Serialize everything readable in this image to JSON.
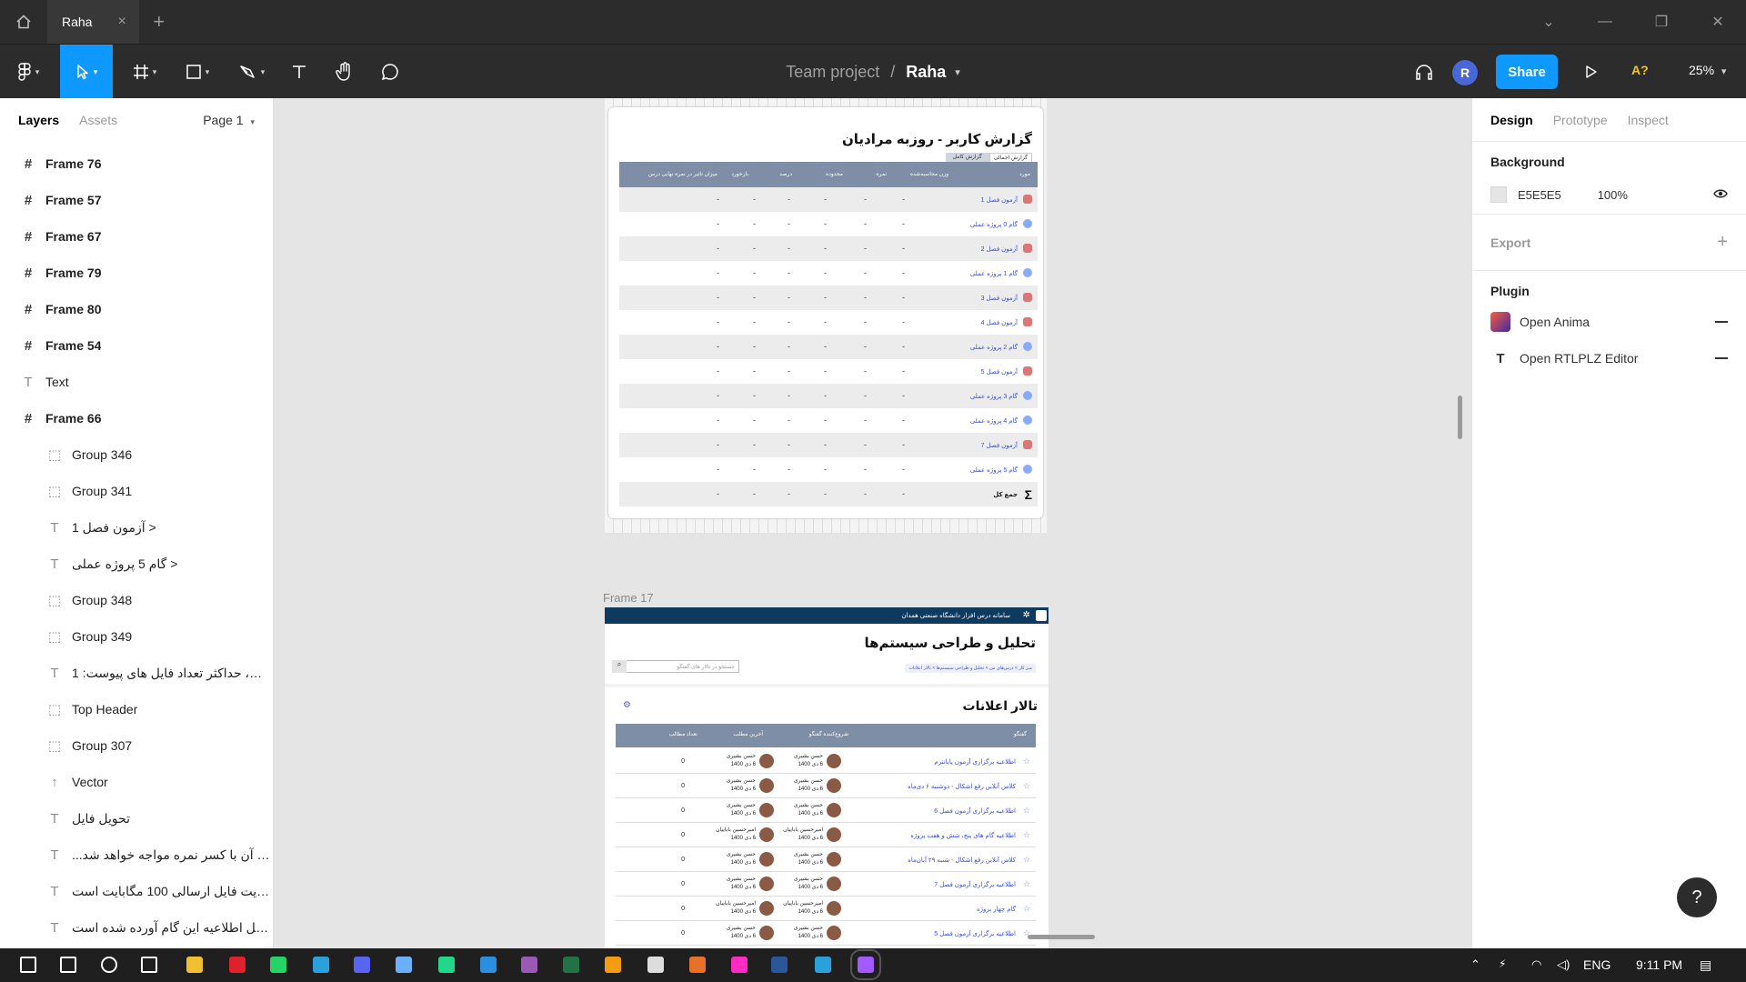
{
  "titlebar": {
    "tab_label": "Raha",
    "tab_close": "×",
    "new_tab": "+",
    "window_controls": [
      "⌄",
      "—",
      "❐",
      "✕"
    ]
  },
  "toolbar": {
    "breadcrumb_team": "Team project",
    "breadcrumb_sep": "/",
    "breadcrumb_file": "Raha",
    "avatar_initial": "R",
    "share_label": "Share",
    "font_check": "A?",
    "zoom": "25%",
    "caret": "▾"
  },
  "left_panel": {
    "tab_layers": "Layers",
    "tab_assets": "Assets",
    "page": "Page 1",
    "layers": [
      {
        "icon": "#",
        "name": "Frame 76",
        "level": "top"
      },
      {
        "icon": "#",
        "name": "Frame 57",
        "level": "top"
      },
      {
        "icon": "#",
        "name": "Frame 67",
        "level": "top"
      },
      {
        "icon": "#",
        "name": "Frame 79",
        "level": "top"
      },
      {
        "icon": "#",
        "name": "Frame 80",
        "level": "top"
      },
      {
        "icon": "#",
        "name": "Frame 54",
        "level": "top"
      },
      {
        "icon": "T",
        "name": "Text",
        "level": "top-plain"
      },
      {
        "icon": "#",
        "name": "Frame 66",
        "level": "top"
      },
      {
        "icon": "⬚",
        "name": "Group 346",
        "level": "child"
      },
      {
        "icon": "⬚",
        "name": "Group 341",
        "level": "child"
      },
      {
        "icon": "T",
        "name": "آزمون فصل 1 >",
        "level": "child"
      },
      {
        "icon": "T",
        "name": "گام 5 پروژه عملی >",
        "level": "child"
      },
      {
        "icon": "⬚",
        "name": "Group 348",
        "level": "child"
      },
      {
        "icon": "⬚",
        "name": "Group 349",
        "level": "child"
      },
      {
        "icon": "T",
        "name": "مگابایت، حداکثر تعداد فایل های پیوست: 1 ...",
        "level": "child"
      },
      {
        "icon": "⬚",
        "name": "Top Header",
        "level": "child"
      },
      {
        "icon": "⬚",
        "name": "Group 307",
        "level": "child"
      },
      {
        "icon": "↑",
        "name": "Vector",
        "level": "child"
      },
      {
        "icon": "T",
        "name": "تحویل فایل",
        "level": "child"
      },
      {
        "icon": "T",
        "name": "...عایت آن با کسر نمره مواجه خواهد شد **",
        "level": "child"
      },
      {
        "icon": "T",
        "name": "محدودیت فایل ارسالی 100 مگابایت است *...",
        "level": "child"
      },
      {
        "icon": "T",
        "name": "ویدیو داخل اطلاعیه این گام آورده شده است...",
        "level": "child"
      }
    ]
  },
  "right_panel": {
    "tabs": [
      "Design",
      "Prototype",
      "Inspect"
    ],
    "background_title": "Background",
    "background_hex": "E5E5E5",
    "background_opacity": "100%",
    "export_title": "Export",
    "plugin_title": "Plugin",
    "plugins": [
      "Open Anima",
      "Open RTLPLZ Editor"
    ]
  },
  "canvas": {
    "report_frame": {
      "title": "گزارش کاربر - روزبه مرادیان",
      "tabs": [
        "گزارش اجمالی",
        "گزارش کامل"
      ],
      "columns": [
        "مورد",
        "وزن محاسبه‌شده",
        "نمره",
        "محدوده",
        "درصد",
        "بازخورد",
        "میزان تاثیر در نمره نهایی درس"
      ],
      "rows": [
        {
          "label": "آزمون فصل 1",
          "kind": "quiz"
        },
        {
          "label": "گام 0 پروژه عملی",
          "kind": "step"
        },
        {
          "label": "آزمون فصل 2",
          "kind": "quiz"
        },
        {
          "label": "گام 1 پروژه عملی",
          "kind": "step"
        },
        {
          "label": "آزمون فصل 3",
          "kind": "quiz"
        },
        {
          "label": "آزمون فصل 4",
          "kind": "quiz"
        },
        {
          "label": "گام 2 پروژه عملی",
          "kind": "step"
        },
        {
          "label": "آزمون فصل 5",
          "kind": "quiz"
        },
        {
          "label": "گام 3 پروژه عملی",
          "kind": "step"
        },
        {
          "label": "گام 4 پروژه عملی",
          "kind": "step"
        },
        {
          "label": "آزمون فصل 7",
          "kind": "quiz"
        },
        {
          "label": "گام 5 پروژه عملی",
          "kind": "step"
        }
      ],
      "total_label": "جمع کل",
      "dash": "-"
    },
    "frame17": {
      "label": "Frame 17",
      "header": "سامانه درس افزار دانشگاه صنعتی همدان",
      "course_title": "تحلیل و طراحی سیستم‌ها",
      "search_placeholder": "جستجو در تالار های گفتگو",
      "breadcrumb": "میز کار > درس‌های من > تحلیل و طراحی سیستم‌ها > تالار اعلانات",
      "forum_title": "تالار اعلانات",
      "columns": [
        "گفتگو",
        "شروع‌کننده گفتگو",
        "آخرین مطلب",
        "تعداد مطالب"
      ],
      "rows": [
        {
          "topic": "اطلاعیه برگزاری آزمون پایانترم",
          "starter": "حسن بشیری",
          "starter_date": "6 دی 1400",
          "last": "حسن بشیری",
          "last_date": "6 دی 1400",
          "count": "0"
        },
        {
          "topic": "کلاس آنلاین رفع اشکال - دوشنبه ۶ دی‌ماه",
          "starter": "حسن بشیری",
          "starter_date": "6 دی 1400",
          "last": "حسن بشیری",
          "last_date": "6 دی 1400",
          "count": "0"
        },
        {
          "topic": "اطلاعیه برگزاری آزمون فصل 6",
          "starter": "حسن بشیری",
          "starter_date": "6 دی 1400",
          "last": "حسن بشیری",
          "last_date": "6 دی 1400",
          "count": "0"
        },
        {
          "topic": "اطلاعیه گام های پنج، شش و هفت پروژه",
          "starter": "امیرحسین باباییان",
          "starter_date": "6 دی 1400",
          "last": "امیرحسین باباییان",
          "last_date": "6 دی 1400",
          "count": "0"
        },
        {
          "topic": "کلاس آنلاین رفع اشکال - شنبه ۲۹ آبان‌ماه",
          "starter": "حسن بشیری",
          "starter_date": "6 دی 1400",
          "last": "حسن بشیری",
          "last_date": "6 دی 1400",
          "count": "0"
        },
        {
          "topic": "اطلاعیه برگزاری آزمون فصل 7",
          "starter": "حسن بشیری",
          "starter_date": "6 دی 1400",
          "last": "حسن بشیری",
          "last_date": "6 دی 1400",
          "count": "0"
        },
        {
          "topic": "گام چهار پروژه",
          "starter": "امیرحسین باباییان",
          "starter_date": "6 دی 1400",
          "last": "امیرحسین باباییان",
          "last_date": "6 دی 1400",
          "count": "0"
        },
        {
          "topic": "اطلاعیه برگزاری آزمون فصل 5",
          "starter": "حسن بشیری",
          "starter_date": "6 دی 1400",
          "last": "حسن بشیری",
          "last_date": "6 دی 1400",
          "count": "0"
        }
      ]
    }
  },
  "help_label": "?",
  "taskbar": {
    "language": "ENG",
    "time": "9:11 PM",
    "apps": [
      "windows-start",
      "search",
      "cortana",
      "task-view",
      "file-explorer",
      "opera",
      "whatsapp",
      "telegram",
      "discord",
      "3d-viewer",
      "pycharm",
      "vscode",
      "manuscript",
      "excel-like",
      "app-generic",
      "wordpad",
      "ardour",
      "adobe-xd",
      "word",
      "telegram-desktop",
      "figma"
    ]
  },
  "colors": {
    "accent": "#0d99ff",
    "dark_bar": "#2c2c2c",
    "canvas": "#e5e5e5",
    "table_header": "#7d8ea6",
    "link_blue": "#3b4ed8"
  }
}
